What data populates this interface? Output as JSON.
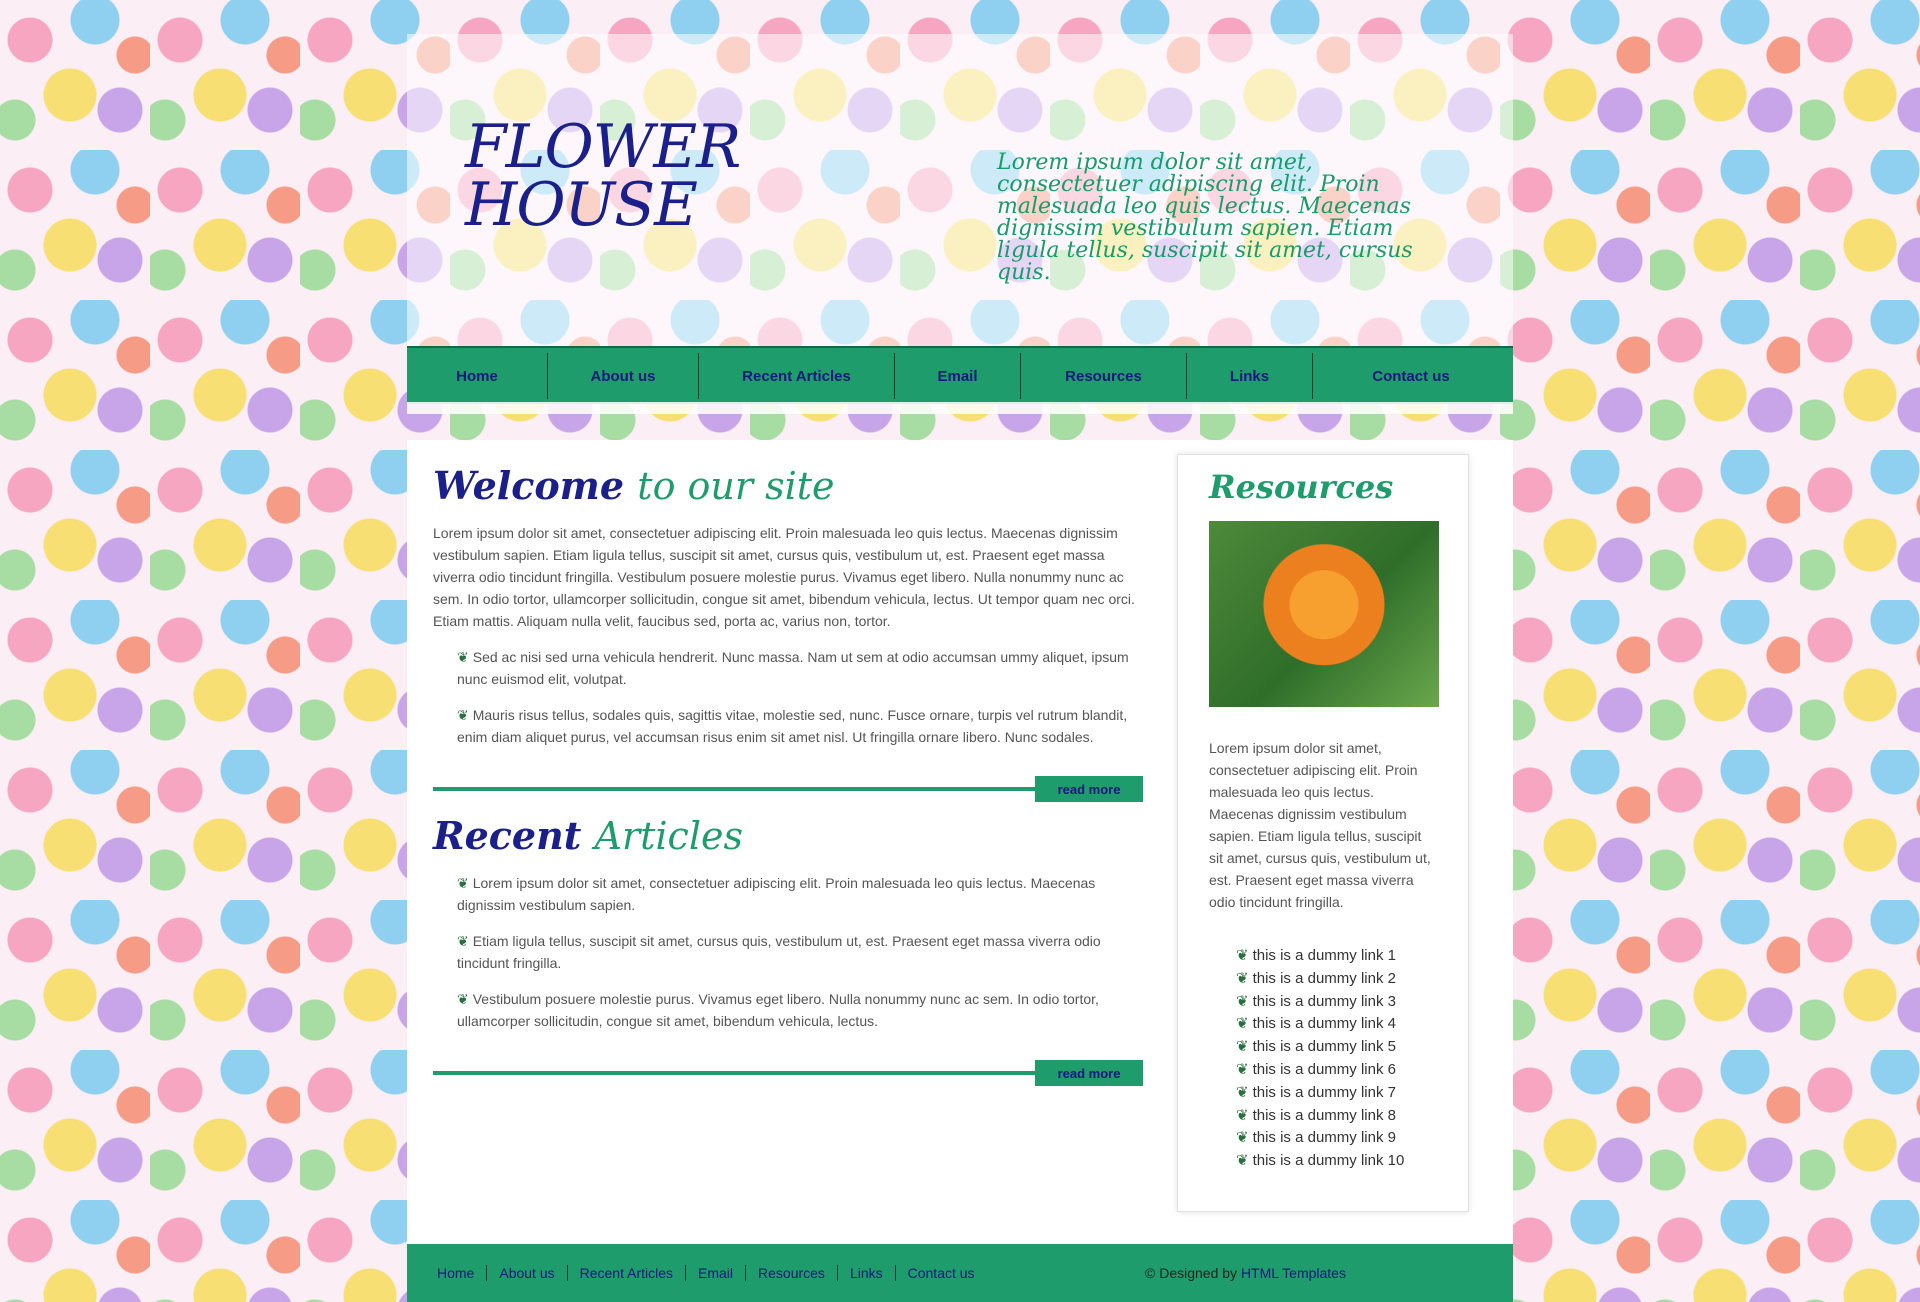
{
  "header": {
    "logo_line1": "FLOWER",
    "logo_line2": "HOUSE",
    "tagline": "Lorem ipsum dolor sit amet, consectetuer adipiscing elit. Proin malesuada leo quis lectus. Maecenas dignissim vestibulum sapien. Etiam ligula tellus, suscipit sit amet, cursus quis."
  },
  "nav": [
    "Home",
    "About us",
    "Recent Articles",
    "Email",
    "Resources",
    "Links",
    "Contact us"
  ],
  "welcome": {
    "title_a": "Welcome",
    "title_b": "to our site",
    "para": "Lorem ipsum dolor sit amet, consectetuer adipiscing elit. Proin malesuada leo quis lectus. Maecenas dignissim vestibulum sapien. Etiam ligula tellus, suscipit sit amet, cursus quis, vestibulum ut, est. Praesent eget massa viverra odio tincidunt fringilla. Vestibulum posuere molestie purus. Vivamus eget libero. Nulla nonummy nunc ac sem. In odio tortor, ullamcorper sollicitudin, congue sit amet, bibendum vehicula, lectus. Ut tempor quam nec orci. Etiam mattis. Aliquam nulla velit, faucibus sed, porta ac, varius non, tortor.",
    "bullets": [
      "Sed ac nisi sed urna vehicula hendrerit. Nunc massa. Nam ut sem at odio accumsan ummy aliquet, ipsum nunc euismod elit, volutpat.",
      "Mauris risus tellus, sodales quis, sagittis vitae, molestie sed, nunc. Fusce ornare, turpis vel rutrum blandit, enim diam aliquet purus, vel accumsan risus enim sit amet nisl. Ut fringilla ornare libero. Nunc sodales."
    ],
    "read_more": "read more"
  },
  "recent": {
    "title_a": "Recent",
    "title_b": "Articles",
    "bullets": [
      "Lorem ipsum dolor sit amet, consectetuer adipiscing elit. Proin malesuada leo quis lectus. Maecenas dignissim vestibulum sapien.",
      "Etiam ligula tellus, suscipit sit amet, cursus quis, vestibulum ut, est. Praesent eget massa viverra odio tincidunt fringilla.",
      "Vestibulum posuere molestie purus. Vivamus eget libero. Nulla nonummy nunc ac sem. In odio tortor, ullamcorper sollicitudin, congue sit amet, bibendum vehicula, lectus."
    ],
    "read_more": "read more"
  },
  "sidebar": {
    "title": "Resources",
    "para": "Lorem ipsum dolor sit amet, consectetuer adipiscing elit. Proin malesuada leo quis lectus. Maecenas dignissim vestibulum sapien. Etiam ligula tellus, suscipit sit amet, cursus quis, vestibulum ut, est. Praesent eget massa viverra odio tincidunt fringilla.",
    "links": [
      "this is a dummy link 1",
      "this is a dummy link 2",
      "this is a dummy link 3",
      "this is a dummy link 4",
      "this is a dummy link 5",
      "this is a dummy link 6",
      "this is a dummy link 7",
      "this is a dummy link 8",
      "this is a dummy link 9",
      "this is a dummy link 10"
    ]
  },
  "footer": {
    "links": [
      "Home",
      "About us",
      "Recent Articles",
      "Email",
      "Resources",
      "Links",
      "Contact us"
    ],
    "credit_prefix": "© Designed by",
    "credit_link": "HTML Templates"
  },
  "colors": {
    "accent_green": "#1e9c6c",
    "navy": "#131a7a"
  },
  "icons": {
    "bullet": "sprout-icon"
  }
}
